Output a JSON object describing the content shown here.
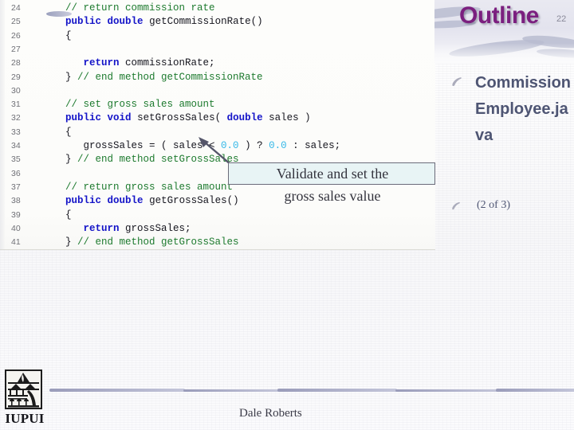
{
  "slide": {
    "title": "Outline",
    "page_number": "22",
    "author": "Dale Roberts",
    "logo_text": "IUPUI"
  },
  "outline": {
    "items": [
      {
        "text": "CommissionEmployee.java",
        "bullet_icon": "swoosh-bullet-icon"
      },
      {
        "text": "(2 of 3)",
        "bullet_icon": "swoosh-bullet-icon"
      }
    ]
  },
  "callout": {
    "line1": "Validate and set the",
    "line2": "gross sales value",
    "box_fill": "#e8f4f5",
    "box_border": "#6b6b7a",
    "arrow_color": "#55566a"
  },
  "colors": {
    "title": "#7b1f7f",
    "outline_text": "#4e5573",
    "comment": "#1d7a2e",
    "keyword": "#1414c8",
    "identifier": "#15151e",
    "number": "#35b8e8",
    "line_number": "#6f7076"
  },
  "code": {
    "language": "java",
    "first_line_number": 24,
    "lines": [
      {
        "n": "24",
        "tokens": [
          {
            "t": "    ",
            "c": "pl"
          },
          {
            "t": "// return commission rate",
            "c": "cm"
          }
        ]
      },
      {
        "n": "25",
        "tokens": [
          {
            "t": "    ",
            "c": "pl"
          },
          {
            "t": "public",
            "c": "kw"
          },
          {
            "t": " ",
            "c": "pl"
          },
          {
            "t": "double",
            "c": "kw"
          },
          {
            "t": " getCommissionRate()",
            "c": "id"
          }
        ]
      },
      {
        "n": "26",
        "tokens": [
          {
            "t": "    {",
            "c": "id"
          }
        ]
      },
      {
        "n": "27",
        "tokens": []
      },
      {
        "n": "28",
        "tokens": [
          {
            "t": "       ",
            "c": "pl"
          },
          {
            "t": "return",
            "c": "kw"
          },
          {
            "t": " commissionRate;",
            "c": "id"
          }
        ]
      },
      {
        "n": "29",
        "tokens": [
          {
            "t": "    }",
            "c": "id"
          },
          {
            "t": " // end method getCommissionRate",
            "c": "cm"
          }
        ]
      },
      {
        "n": "30",
        "tokens": []
      },
      {
        "n": "31",
        "tokens": [
          {
            "t": "    ",
            "c": "pl"
          },
          {
            "t": "// set gross sales amount",
            "c": "cm"
          }
        ]
      },
      {
        "n": "32",
        "tokens": [
          {
            "t": "    ",
            "c": "pl"
          },
          {
            "t": "public",
            "c": "kw"
          },
          {
            "t": " ",
            "c": "pl"
          },
          {
            "t": "void",
            "c": "kw"
          },
          {
            "t": " setGrossSales( ",
            "c": "id"
          },
          {
            "t": "double",
            "c": "kw"
          },
          {
            "t": " sales )",
            "c": "id"
          }
        ]
      },
      {
        "n": "33",
        "tokens": [
          {
            "t": "    {",
            "c": "id"
          }
        ]
      },
      {
        "n": "34",
        "tokens": [
          {
            "t": "       grossSales = ( sales < ",
            "c": "id"
          },
          {
            "t": "0.0",
            "c": "num"
          },
          {
            "t": " ) ? ",
            "c": "id"
          },
          {
            "t": "0.0",
            "c": "num"
          },
          {
            "t": " : sales;",
            "c": "id"
          }
        ]
      },
      {
        "n": "35",
        "tokens": [
          {
            "t": "    }",
            "c": "id"
          },
          {
            "t": " // end method setGrossSales",
            "c": "cm"
          }
        ]
      },
      {
        "n": "36",
        "tokens": []
      },
      {
        "n": "37",
        "tokens": [
          {
            "t": "    ",
            "c": "pl"
          },
          {
            "t": "// return gross sales amount",
            "c": "cm"
          }
        ]
      },
      {
        "n": "38",
        "tokens": [
          {
            "t": "    ",
            "c": "pl"
          },
          {
            "t": "public",
            "c": "kw"
          },
          {
            "t": " ",
            "c": "pl"
          },
          {
            "t": "double",
            "c": "kw"
          },
          {
            "t": " getGrossSales()",
            "c": "id"
          }
        ]
      },
      {
        "n": "39",
        "tokens": [
          {
            "t": "    {",
            "c": "id"
          }
        ]
      },
      {
        "n": "40",
        "tokens": [
          {
            "t": "       ",
            "c": "pl"
          },
          {
            "t": "return",
            "c": "kw"
          },
          {
            "t": " grossSales;",
            "c": "id"
          }
        ]
      },
      {
        "n": "41",
        "tokens": [
          {
            "t": "    }",
            "c": "id"
          },
          {
            "t": " // end method getGrossSales",
            "c": "cm"
          }
        ]
      }
    ],
    "display_line_numbers": [
      "24",
      "25",
      "26",
      "27",
      "28",
      "29",
      "30",
      "31",
      "32",
      "33",
      "34",
      "35",
      "36",
      "37",
      "38",
      "39",
      "40",
      "41"
    ]
  }
}
